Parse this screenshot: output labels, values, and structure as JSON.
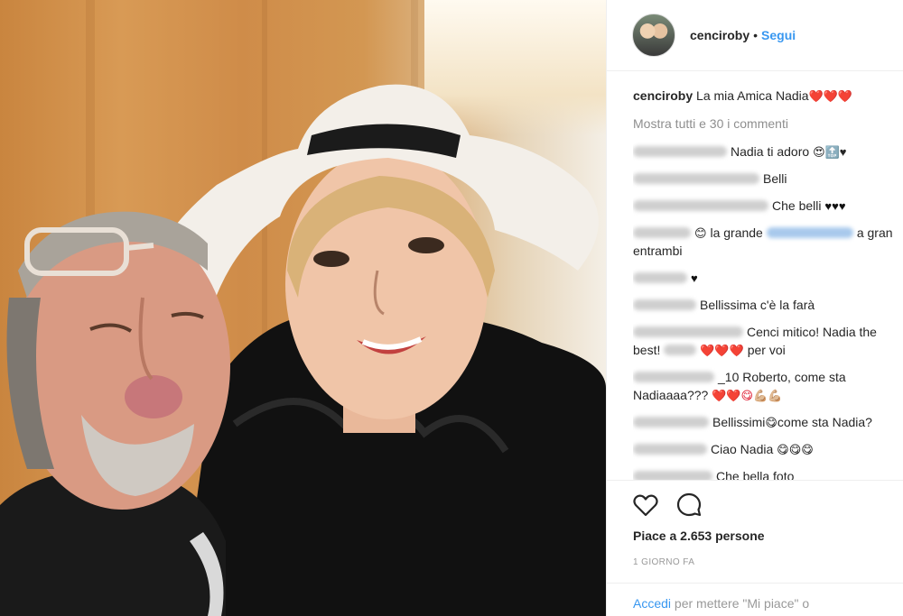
{
  "post": {
    "username": "cenciroby",
    "separator": "•",
    "follow_label": "Segui",
    "caption_text": "La mia Amica Nadia",
    "caption_emoji": "❤️❤️❤️",
    "show_all_comments": "Mostra tutti e 30 i commenti",
    "likes": "Piace a 2.653 persone",
    "time_ago": "1 GIORNO FA",
    "login_link": "Accedi",
    "login_rest": " per mettere \"Mi piace\" o"
  },
  "comments": [
    {
      "text": "Nadia ti adoro",
      "emoji": "😍🔝♥"
    },
    {
      "text": "Belli",
      "emoji": ""
    },
    {
      "text": "Che belli",
      "emoji": "♥♥♥"
    },
    {
      "emoji_pre": "😊",
      "text": "la grande",
      "text_after": "a gran",
      "text_line2": "entrambi"
    },
    {
      "text": "",
      "emoji": "♥"
    },
    {
      "text": "Bellissima c'è la farà",
      "emoji": ""
    },
    {
      "text": "Cenci mitico! Nadia the",
      "text_line2_pre": "best!",
      "emoji": "❤️❤️❤️",
      "text_line2": "per voi"
    },
    {
      "text": "_10 Roberto, come sta",
      "text_line2": "Nadiaaaa???",
      "emoji": "❤️❤️😋💪🏼💪🏼"
    },
    {
      "text": "Bellissimi",
      "emoji": "😋",
      "text_after": "come sta Nadia?"
    },
    {
      "text": "Ciao Nadia",
      "emoji": "😋😋😋"
    },
    {
      "text": "Che bella foto",
      "emoji": ""
    }
  ],
  "icons": {
    "like": "heart-outline-icon",
    "comment": "speech-bubble-icon"
  },
  "colors": {
    "accent": "#3897f0",
    "text": "#262626",
    "muted": "#8e8e8e"
  }
}
